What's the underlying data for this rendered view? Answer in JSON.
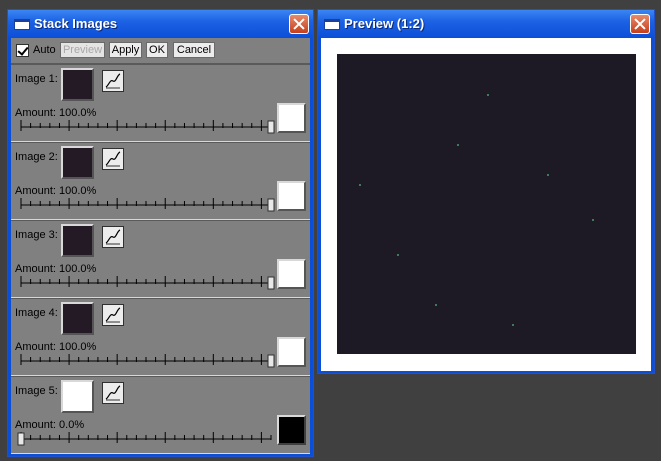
{
  "stack_window": {
    "title": "Stack Images",
    "toolbar": {
      "auto_label": "Auto",
      "auto_checked": true,
      "preview_label": "Preview",
      "apply_label": "Apply",
      "ok_label": "OK",
      "cancel_label": "Cancel"
    },
    "images": [
      {
        "label": "Image 1:",
        "amount_text": "Amount: 100.0%",
        "amount": 1.0,
        "thumb": "dark",
        "swatch": "#ffffff"
      },
      {
        "label": "Image 2:",
        "amount_text": "Amount: 100.0%",
        "amount": 1.0,
        "thumb": "dark",
        "swatch": "#ffffff"
      },
      {
        "label": "Image 3:",
        "amount_text": "Amount: 100.0%",
        "amount": 1.0,
        "thumb": "dark",
        "swatch": "#ffffff"
      },
      {
        "label": "Image 4:",
        "amount_text": "Amount: 100.0%",
        "amount": 1.0,
        "thumb": "dark",
        "swatch": "#ffffff"
      },
      {
        "label": "Image 5:",
        "amount_text": "Amount: 0.0%",
        "amount": 0.0,
        "thumb": "white",
        "swatch": "#000000"
      }
    ]
  },
  "preview_window": {
    "title": "Preview (1:2)"
  },
  "icons": {
    "window": "window-icon",
    "close": "close-icon",
    "curve": "curve-icon"
  },
  "colors": {
    "titlebar": "#0b4fd8",
    "panel": "#808080",
    "preview_image": "#1d1925"
  }
}
